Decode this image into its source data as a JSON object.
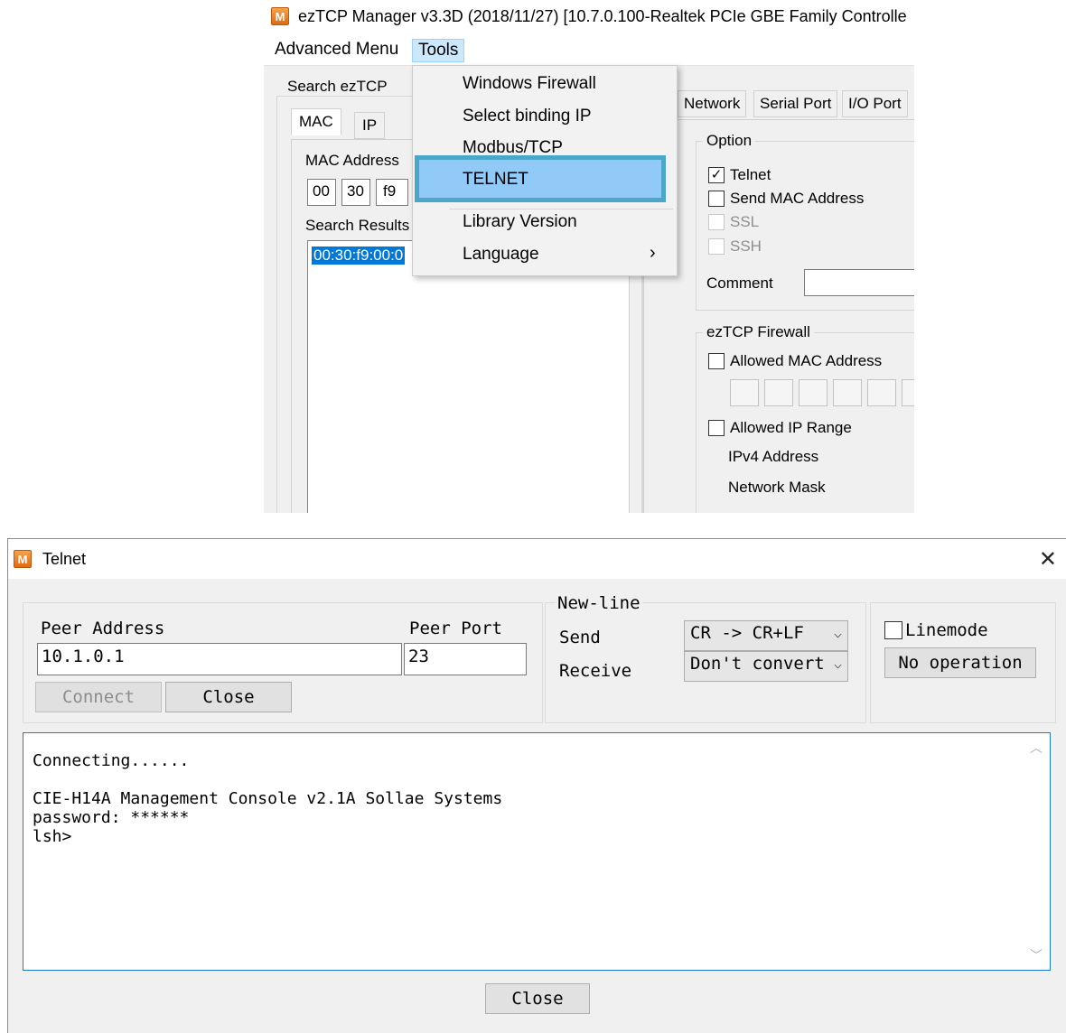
{
  "manager": {
    "icon_letter": "M",
    "title": "ezTCP Manager v3.3D (2018/11/27) [10.7.0.100-Realtek PCIe GBE Family Controlle",
    "menu": [
      "Advanced Menu",
      "Tools"
    ],
    "search_group": "Search ezTCP",
    "tabs": [
      "MAC",
      "IP"
    ],
    "mac_address_label": "MAC Address",
    "mac_octets": [
      "00",
      "30",
      "f9"
    ],
    "search_results_label": "Search Results",
    "search_result_item": "00:30:f9:00:0",
    "right_tabs": [
      "Network",
      "Serial Port",
      "I/O Port"
    ],
    "option_group": "Option",
    "options": [
      {
        "label": "Telnet",
        "checked": true,
        "enabled": true
      },
      {
        "label": "Send MAC Address",
        "checked": false,
        "enabled": true
      },
      {
        "label": "SSL",
        "checked": false,
        "enabled": false
      },
      {
        "label": "SSH",
        "checked": false,
        "enabled": false
      }
    ],
    "comment_label": "Comment",
    "firewall_group": "ezTCP Firewall",
    "allowed_mac_label": "Allowed MAC Address",
    "allowed_ip_label": "Allowed IP Range",
    "ipv4_label": "IPv4 Address",
    "netmask_label": "Network Mask"
  },
  "tools_menu": {
    "items": [
      "Windows Firewall",
      "Select binding IP",
      "Modbus/TCP",
      "TELNET",
      "Library Version",
      "Language"
    ],
    "highlighted": "TELNET",
    "submenu_arrow": "›"
  },
  "telnet": {
    "icon_letter": "M",
    "title": "Telnet",
    "close_glyph": "✕",
    "peer_address_label": "Peer Address",
    "peer_address_value": "10.1.0.1",
    "peer_port_label": "Peer Port",
    "peer_port_value": "23",
    "connect_button": "Connect",
    "close_button_top": "Close",
    "newline_group": "New-line",
    "send_label": "Send",
    "send_value": "CR -> CR+LF",
    "receive_label": "Receive",
    "receive_value": "Don't convert",
    "linemode_label": "Linemode",
    "linemode_checked": false,
    "no_operation_button": "No operation",
    "console_lines": "Connecting......\n\nCIE-H14A Management Console v2.1A Sollae Systems\npassword: ******\nlsh>",
    "close_button_bottom": "Close"
  },
  "colors": {
    "selection_blue": "#0078d7",
    "highlight_border": "#4aa7c9",
    "console_border": "#1f7bd1"
  }
}
